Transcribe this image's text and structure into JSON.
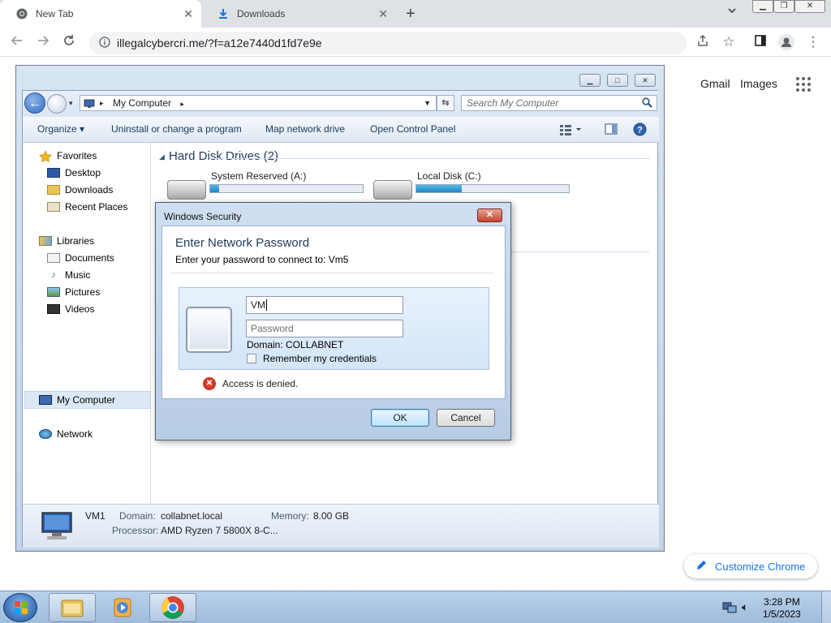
{
  "browser": {
    "tabs": [
      {
        "label": "New Tab",
        "icon": "chrome-icon"
      },
      {
        "label": "Downloads",
        "icon": "download-icon"
      }
    ],
    "new_tab_symbol": "+",
    "tab_close_symbol": "✕",
    "url": "illegalcybercri.me/?f=a12e7440d1fd7e9e"
  },
  "page": {
    "gmail": "Gmail",
    "images": "Images",
    "customize": "Customize Chrome"
  },
  "explorer": {
    "address": "My Computer",
    "search_placeholder": "Search My Computer",
    "commands": [
      "Organize ▾",
      "Uninstall or change a program",
      "Map network drive",
      "Open Control Panel"
    ],
    "nav": {
      "favorites": "Favorites",
      "desktop": "Desktop",
      "downloads": "Downloads",
      "recent": "Recent Places",
      "libraries": "Libraries",
      "documents": "Documents",
      "music": "Music",
      "pictures": "Pictures",
      "videos": "Videos",
      "mycomputer": "My Computer",
      "network": "Network"
    },
    "section_title": "Hard Disk Drives (2)",
    "drives": [
      {
        "name": "System Reserved (A:)",
        "used_fraction": 0.06
      },
      {
        "name": "Local Disk (C:)",
        "used_fraction": 0.3
      }
    ],
    "details": {
      "computer_name": "VM1",
      "domain_label": "Domain:",
      "domain_value": "collabnet.local",
      "memory_label": "Memory:",
      "memory_value": "8.00 GB",
      "processor_label": "Processor:",
      "processor_value": "AMD Ryzen 7 5800X 8-C..."
    }
  },
  "dialog": {
    "title": "Windows Security",
    "heading": "Enter Network Password",
    "subtitle": "Enter your password to connect to: Vm5",
    "username_value": "VM",
    "password_placeholder": "Password",
    "domain": "Domain: COLLABNET",
    "remember": "Remember my credentials",
    "error": "Access is denied.",
    "ok": "OK",
    "cancel": "Cancel"
  },
  "taskbar": {
    "time": "3:28 PM",
    "date": "1/5/2023"
  },
  "colors": {
    "chrome_accent": "#1a73e8",
    "win7_blue": "#1e395b",
    "error_red": "#c42b1c"
  }
}
